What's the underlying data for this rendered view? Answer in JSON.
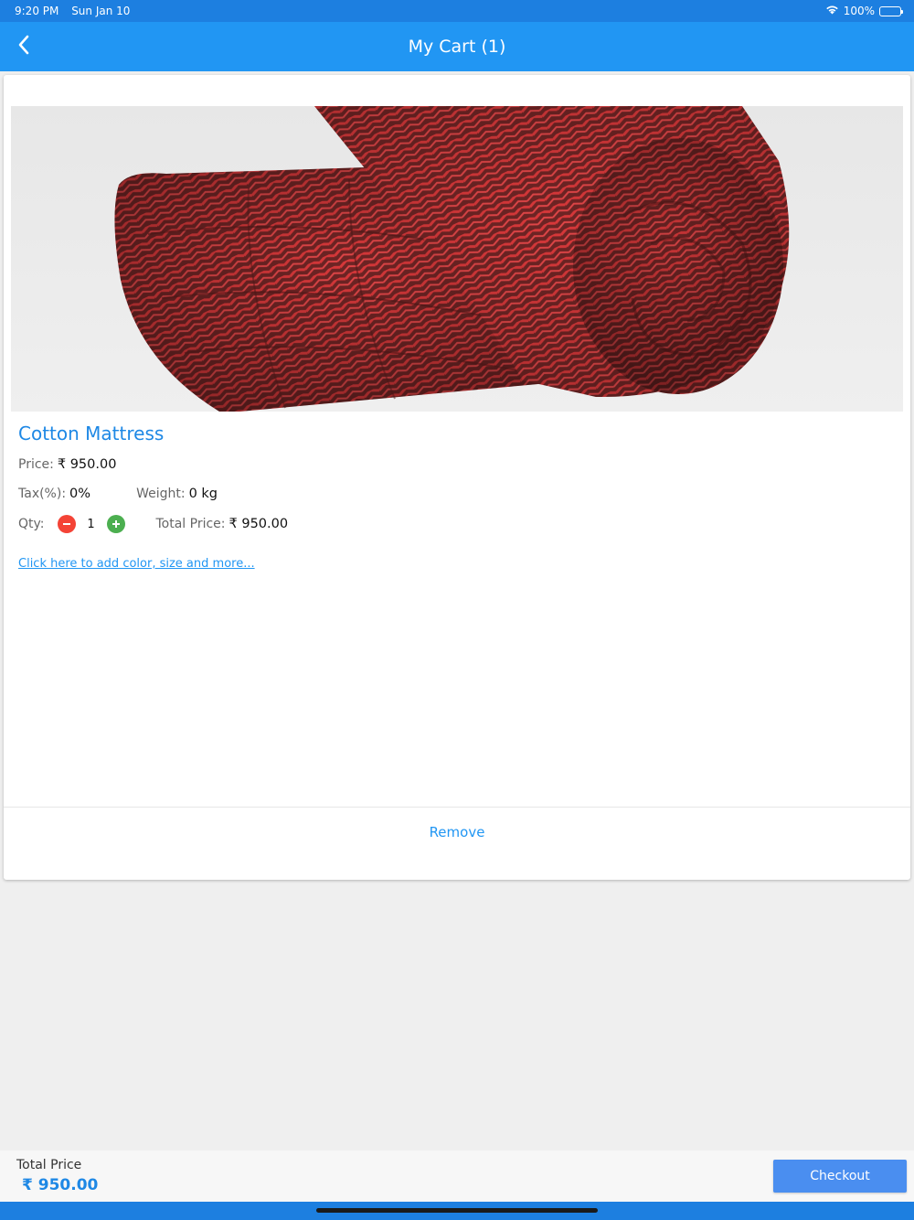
{
  "status_bar": {
    "time": "9:20 PM",
    "date": "Sun Jan 10",
    "battery": "100%"
  },
  "nav": {
    "back_icon": "chevron-left-icon",
    "title": "My Cart (1)"
  },
  "cart_item": {
    "image_description": "red-quilted-cotton-mattress-rolled",
    "name": "Cotton Mattress",
    "price_label": "Price:",
    "price": "₹ 950.00",
    "tax_label": "Tax(%):",
    "tax": "0%",
    "weight_label": "Weight:",
    "weight": "0 kg",
    "qty_label": "Qty:",
    "qty": "1",
    "total_label": "Total Price:",
    "total": "₹ 950.00",
    "options_link": "Click here to add color, size and more...",
    "remove_label": "Remove"
  },
  "footer": {
    "total_label": "Total Price",
    "total_value": "₹ 950.00",
    "checkout_label": "Checkout"
  },
  "colors": {
    "primary": "#2196f3",
    "status_bar": "#1d7fe0",
    "minus": "#f44336",
    "plus": "#4caf50",
    "checkout": "#4a8ef0"
  }
}
